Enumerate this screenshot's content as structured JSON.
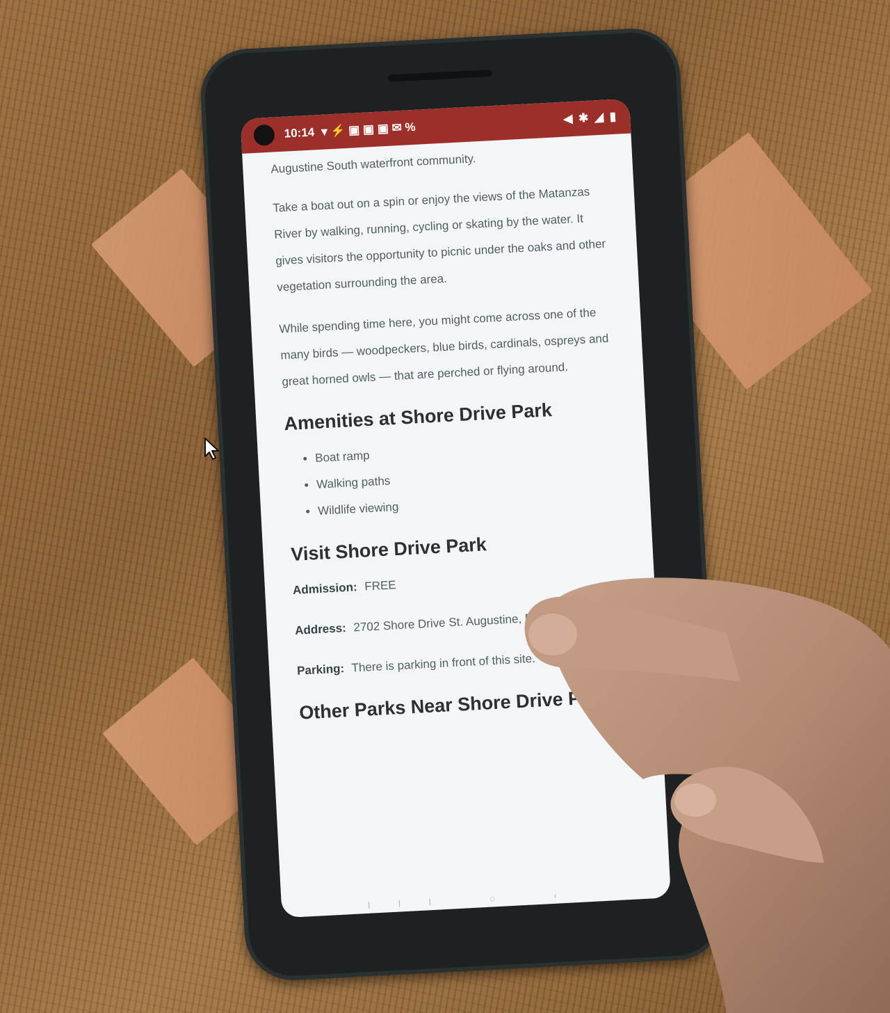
{
  "status_bar": {
    "time": "10:14",
    "left_icons": "▾ ⚡ ▣ ▣ ▣ ✉ %",
    "right_icons": "◀ ✱ ◢ ▮"
  },
  "article": {
    "intro_tail": "Augustine South waterfront community.",
    "paragraph1": "Take a boat out on a spin or enjoy the views of the Matanzas River by walking, running, cycling or skating by the water. It gives visitors the opportunity to picnic under the oaks and other vegetation surrounding the area.",
    "paragraph2": "While spending time here, you might come across one of the many birds — woodpeckers, blue birds, cardinals, ospreys and great horned owls — that are perched or flying around.",
    "amenities_heading": "Amenities at Shore Drive Park",
    "amenities": [
      "Boat ramp",
      "Walking paths",
      "Wildlife viewing"
    ],
    "visit_heading": "Visit Shore Drive Park",
    "admission_label": "Admission:",
    "admission_value": "FREE",
    "address_label": "Address:",
    "address_value": "2702 Shore Drive St. Augustine, Florida 32086",
    "parking_label": "Parking:",
    "parking_value": "There is parking in front of this site.",
    "other_heading": "Other Parks Near Shore Drive Park",
    "nav_hint": "III ○ ‹"
  }
}
